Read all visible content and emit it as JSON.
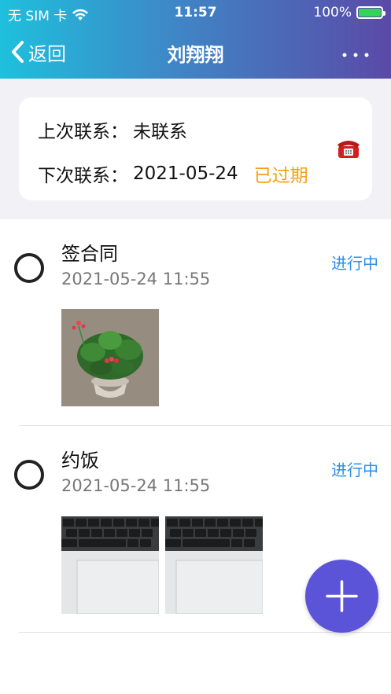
{
  "status_bar": {
    "carrier": "无 SIM 卡",
    "time": "11:57",
    "battery_text": "100%",
    "battery_level": 1.0
  },
  "nav": {
    "back_label": "返回",
    "title": "刘翔翔",
    "more_icon": "more-dots-icon"
  },
  "contact": {
    "last_label": "上次联系：",
    "last_value": "未联系",
    "next_label": "下次联系：",
    "next_value": "2021-05-24",
    "next_status": "已过期",
    "phone_icon": "telephone-icon"
  },
  "tasks": [
    {
      "title": "签合同",
      "time": "2021-05-24 11:55",
      "status": "进行中",
      "photos": [
        "plant-photo"
      ]
    },
    {
      "title": "约饭",
      "time": "2021-05-24 11:55",
      "status": "进行中",
      "photos": [
        "keyboard-photo",
        "keyboard-photo"
      ]
    }
  ],
  "fab_icon": "plus-icon",
  "colors": {
    "header_gradient": [
      "#1ec0dd",
      "#5a4aa8"
    ],
    "overdue": "#f5a01b",
    "status": "#2d8ee6",
    "fab": "#5b54d9"
  }
}
